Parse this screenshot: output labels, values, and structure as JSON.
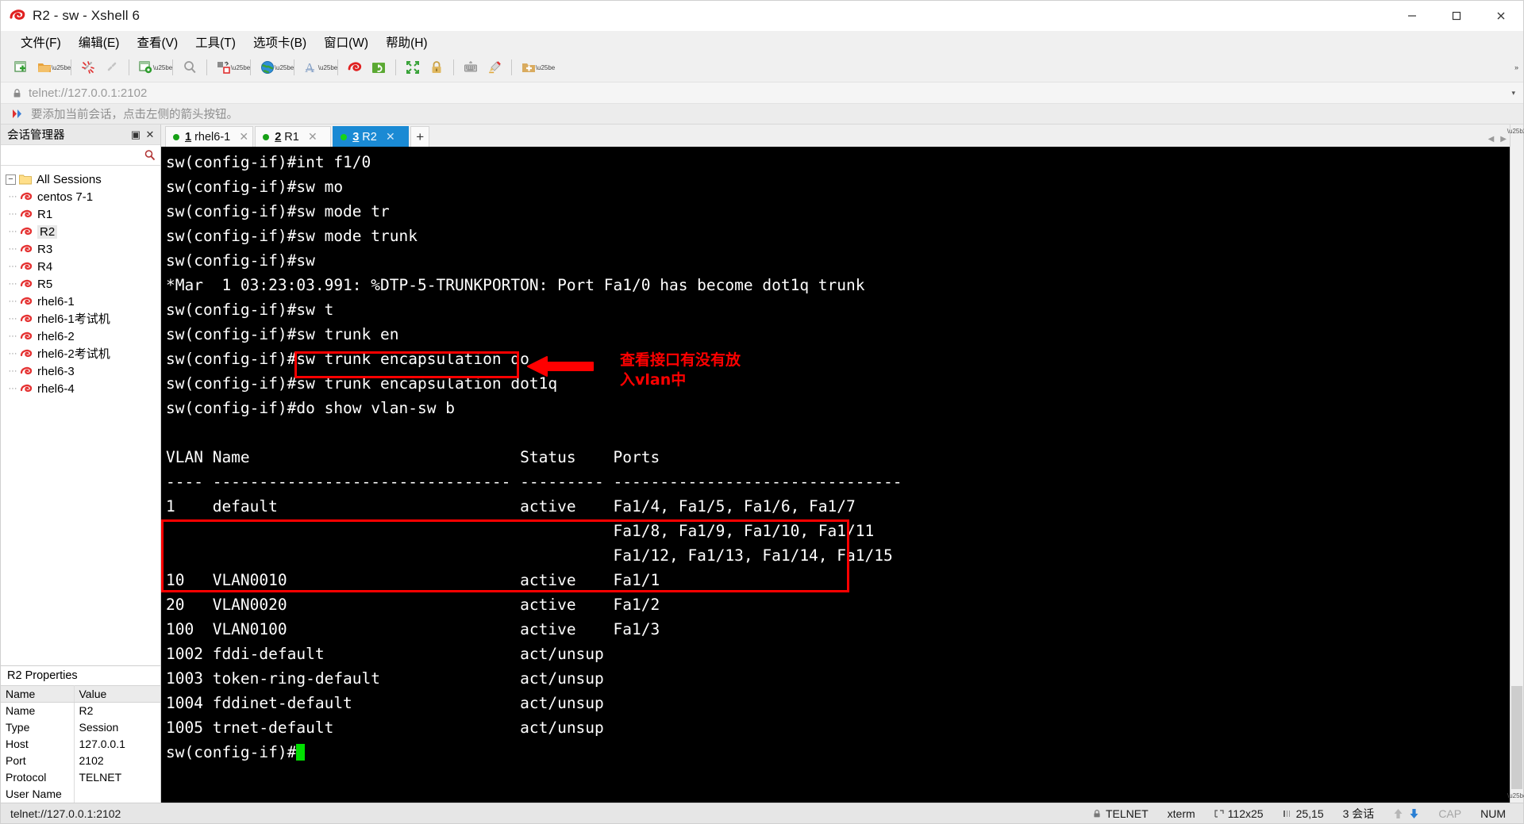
{
  "window": {
    "title": "R2 - sw - Xshell 6",
    "app_icon": "xshell-logo-icon",
    "minimize": "—",
    "maximize": "❐",
    "close": "✕"
  },
  "menubar": {
    "items": [
      {
        "label": "文件(F)",
        "name": "menu-file"
      },
      {
        "label": "编辑(E)",
        "name": "menu-edit"
      },
      {
        "label": "查看(V)",
        "name": "menu-view"
      },
      {
        "label": "工具(T)",
        "name": "menu-tools"
      },
      {
        "label": "选项卡(B)",
        "name": "menu-tabs"
      },
      {
        "label": "窗口(W)",
        "name": "menu-window"
      },
      {
        "label": "帮助(H)",
        "name": "menu-help"
      }
    ]
  },
  "toolbar": {
    "buttons": [
      "new-session-icon",
      "open-folder-icon",
      "disconnect-icon",
      "reconnect-icon",
      "session-properties-icon",
      "find-icon",
      "layout-icon",
      "globe-icon",
      "font-icon",
      "xshell-icon",
      "xftp-icon",
      "fullscreen-icon",
      "lock-icon",
      "keyboard-icon",
      "highlight-icon",
      "add-folder-icon"
    ],
    "overflow": "»"
  },
  "address_bar": {
    "lock_icon": "lock-icon",
    "url": "telnet://127.0.0.1:2102",
    "dropdown": "▾"
  },
  "notice_bar": {
    "icon": "arrow-add-icon",
    "text": "要添加当前会话，点击左侧的箭头按钮。"
  },
  "sidebar": {
    "title": "会话管理器",
    "pin": "▣",
    "close": "✕",
    "search_icon": "search-icon",
    "root": {
      "label": "All Sessions",
      "expander": "−",
      "icon": "folder-icon"
    },
    "sessions": [
      {
        "label": "centos 7-1",
        "selected": false
      },
      {
        "label": "R1",
        "selected": false
      },
      {
        "label": "R2",
        "selected": true
      },
      {
        "label": "R3",
        "selected": false
      },
      {
        "label": "R4",
        "selected": false
      },
      {
        "label": "R5",
        "selected": false
      },
      {
        "label": "rhel6-1",
        "selected": false
      },
      {
        "label": "rhel6-1考试机",
        "selected": false
      },
      {
        "label": "rhel6-2",
        "selected": false
      },
      {
        "label": "rhel6-2考试机",
        "selected": false
      },
      {
        "label": "rhel6-3",
        "selected": false
      },
      {
        "label": "rhel6-4",
        "selected": false
      }
    ]
  },
  "properties": {
    "title": "R2 Properties",
    "header": {
      "key": "Name",
      "value": "Value"
    },
    "rows": [
      {
        "key": "Name",
        "value": "R2"
      },
      {
        "key": "Type",
        "value": "Session"
      },
      {
        "key": "Host",
        "value": "127.0.0.1"
      },
      {
        "key": "Port",
        "value": "2102"
      },
      {
        "key": "Protocol",
        "value": "TELNET"
      },
      {
        "key": "User Name",
        "value": ""
      }
    ]
  },
  "tabs": {
    "items": [
      {
        "num": "1",
        "label": "rhel6-1",
        "active": false,
        "close": "✕"
      },
      {
        "num": "2",
        "label": "R1",
        "active": false,
        "close": "✕"
      },
      {
        "num": "3",
        "label": "R2",
        "active": true,
        "close": "✕"
      }
    ],
    "new_tab": "+",
    "nav_left": "◀",
    "nav_right": "▶"
  },
  "terminal": {
    "lines": [
      "sw(config-if)#int f1/0",
      "sw(config-if)#sw mo",
      "sw(config-if)#sw mode tr",
      "sw(config-if)#sw mode trunk",
      "sw(config-if)#sw",
      "*Mar  1 03:23:03.991: %DTP-5-TRUNKPORTON: Port Fa1/0 has become dot1q trunk",
      "sw(config-if)#sw t",
      "sw(config-if)#sw trunk en",
      "sw(config-if)#sw trunk encapsulation do",
      "sw(config-if)#sw trunk encapsulation dot1q",
      "sw(config-if)#do show vlan-sw b",
      "",
      "VLAN Name                             Status    Ports",
      "---- -------------------------------- --------- -------------------------------",
      "1    default                          active    Fa1/4, Fa1/5, Fa1/6, Fa1/7",
      "                                                Fa1/8, Fa1/9, Fa1/10, Fa1/11",
      "                                                Fa1/12, Fa1/13, Fa1/14, Fa1/15",
      "10   VLAN0010                         active    Fa1/1",
      "20   VLAN0020                         active    Fa1/2",
      "100  VLAN0100                         active    Fa1/3",
      "1002 fddi-default                     act/unsup",
      "1003 token-ring-default               act/unsup",
      "1004 fddinet-default                  act/unsup",
      "1005 trnet-default                    act/unsup",
      "sw(config-if)#"
    ],
    "cursor": "block-cursor"
  },
  "annotations": {
    "command_box": "do show vlan-sw b",
    "arrow": "left-arrow-icon",
    "note_line1": "查看接口有没有放",
    "note_line2": "入vlan中",
    "vlan_box": "vlan-rows-highlight",
    "color": "#ff0000"
  },
  "statusbar": {
    "url": "telnet://127.0.0.1:2102",
    "lock_icon": "lock-icon",
    "protocol": "TELNET",
    "term_type": "xterm",
    "size_icon": "terminal-size-icon",
    "size": "112x25",
    "cursor_icon": "cursor-pos-icon",
    "cursor_pos": "25,15",
    "sessions": "3 会话",
    "up_icon": "upload-arrow-icon",
    "down_icon": "download-arrow-icon",
    "cap": "CAP",
    "num": "NUM"
  }
}
